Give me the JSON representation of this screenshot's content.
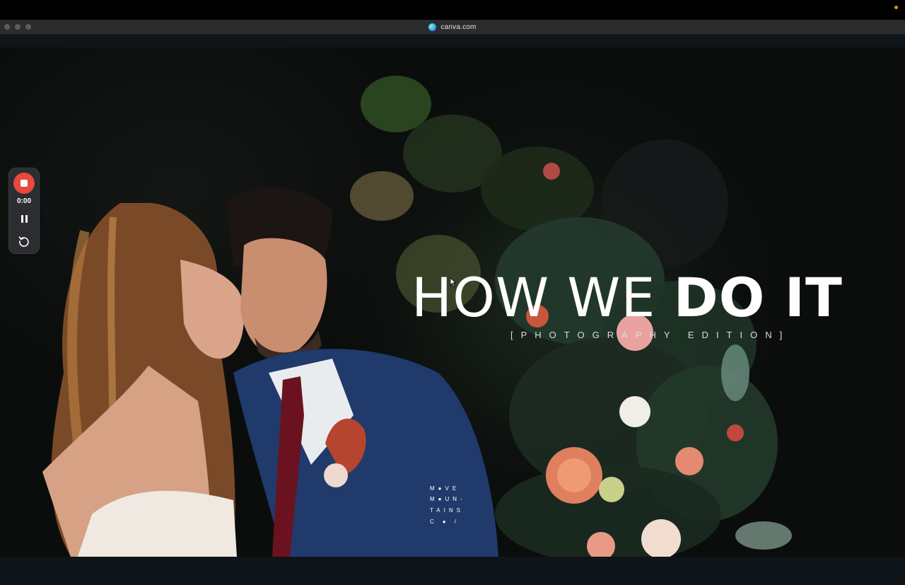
{
  "browser": {
    "url": "canva.com"
  },
  "recorder": {
    "timer": "0:00"
  },
  "slide": {
    "headline_light": "HOW WE ",
    "headline_bold": "DO IT",
    "subtitle": "[PHOTOGRAPHY EDITION]",
    "logo_lines": [
      "M●VE",
      "M●UN-",
      "TAINS",
      "C●/"
    ]
  },
  "colors": {
    "record_red": "#e8483e",
    "background": "#0b0d0c",
    "headline": "#ffffff"
  },
  "icons": {
    "site": "canva-logo-icon",
    "stop": "stop-icon",
    "pause": "pause-icon",
    "restart": "restart-icon",
    "cursor": "mouse-pointer-icon"
  }
}
